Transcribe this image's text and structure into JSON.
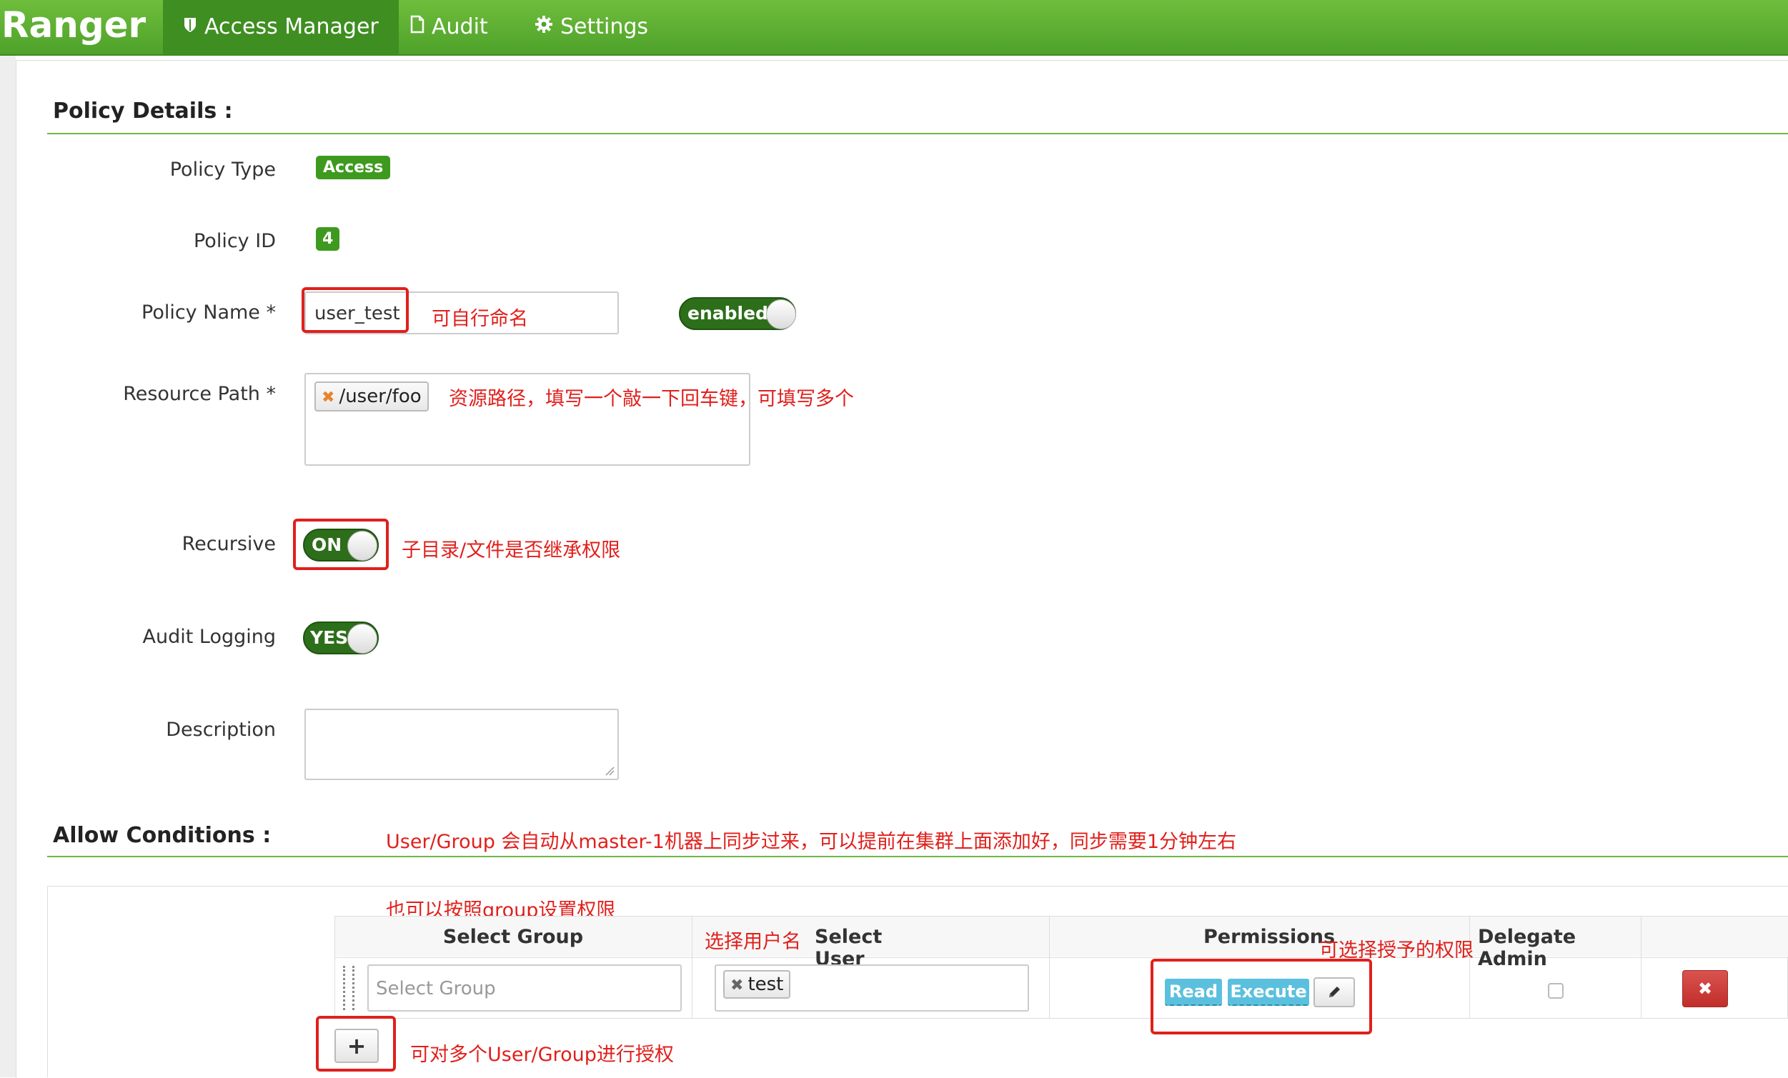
{
  "nav": {
    "brand": "Ranger",
    "items": [
      {
        "label": "Access Manager",
        "icon": "shield-icon"
      },
      {
        "label": "Audit",
        "icon": "file-icon"
      },
      {
        "label": "Settings",
        "icon": "gear-icon"
      }
    ]
  },
  "policy_details": {
    "title": "Policy Details :",
    "policy_type_label": "Policy Type",
    "policy_type_value": "Access",
    "policy_id_label": "Policy ID",
    "policy_id_value": "4",
    "policy_name_label": "Policy Name *",
    "policy_name_value": "user_test",
    "enabled_toggle": "enabled",
    "resource_path_label": "Resource Path *",
    "resource_path_tag": "/user/foo",
    "recursive_label": "Recursive",
    "recursive_toggle": "ON",
    "audit_logging_label": "Audit Logging",
    "audit_logging_toggle": "YES",
    "description_label": "Description"
  },
  "allow_conditions": {
    "title": "Allow Conditions :",
    "headers": {
      "select_group": "Select Group",
      "select_user": "Select User",
      "permissions": "Permissions",
      "delegate_admin": "Delegate Admin"
    },
    "row": {
      "group_placeholder": "Select Group",
      "user_tag": "test",
      "permissions": [
        "Read",
        "Execute"
      ]
    },
    "add_button": "+"
  },
  "annotations": {
    "policy_name": "可自行命名",
    "resource_path": "资源路径，填写一个敲一下回车键，可填写多个",
    "recursive": "子目录/文件是否继承权限",
    "user_group_sync": "User/Group 会自动从master-1机器上同步过来，可以提前在集群上面添加好，同步需要1分钟左右",
    "group_perm": "也可以按照group设置权限",
    "select_user": "选择用户名",
    "permissions": "可选择授予的权限",
    "add_more": "可对多个User/Group进行授权"
  },
  "colors": {
    "nav_green": "#5aad31",
    "accent_red": "#e0201c",
    "badge_green": "#3e9a1f",
    "perm_blue": "#5bc0de",
    "delete_red": "#c9302c"
  }
}
